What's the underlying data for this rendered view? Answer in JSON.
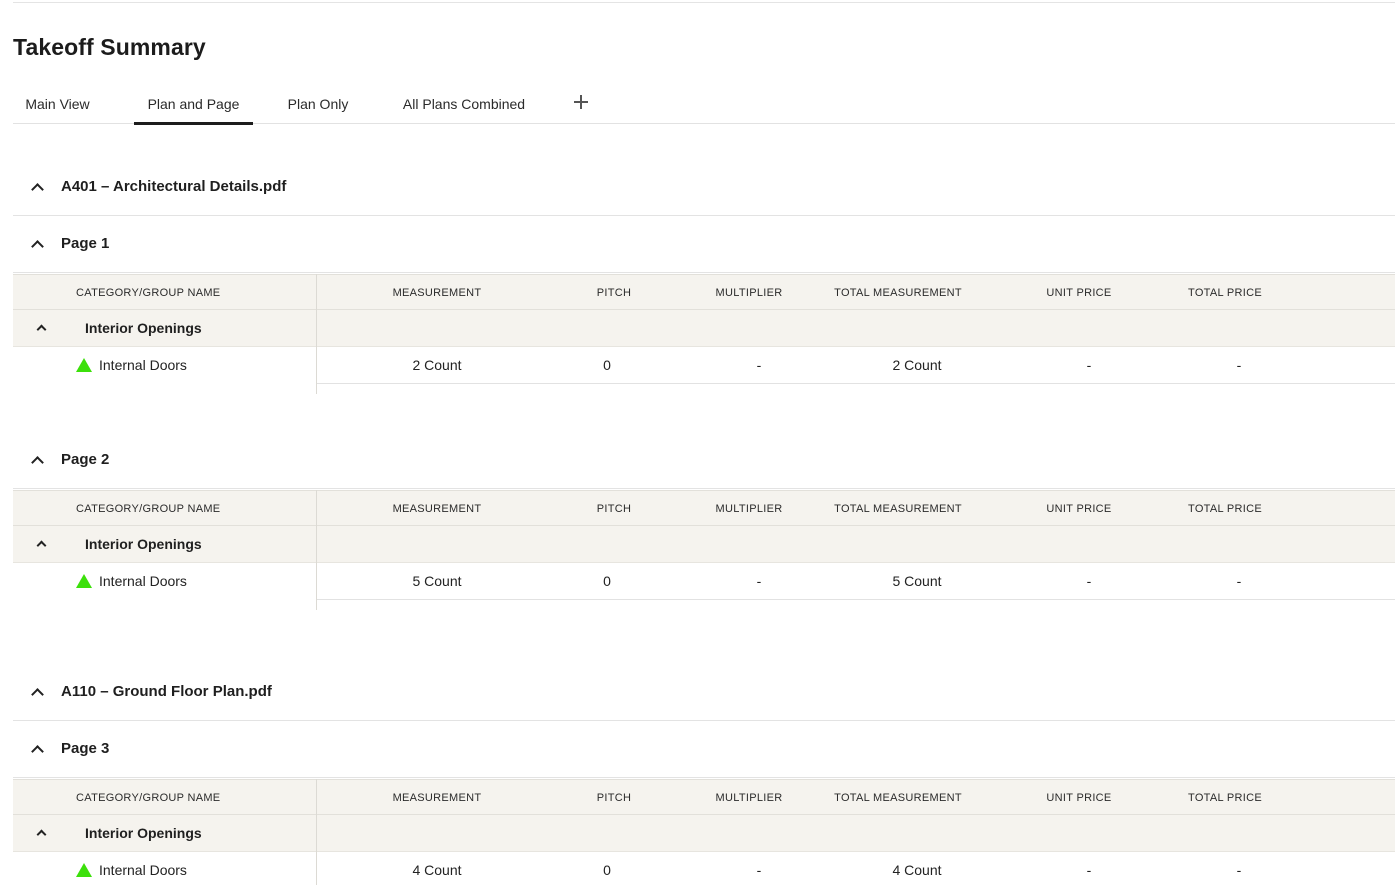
{
  "title": "Takeoff Summary",
  "tabs": [
    {
      "label": "Main View",
      "active": false
    },
    {
      "label": "Plan and Page",
      "active": true
    },
    {
      "label": "Plan Only",
      "active": false
    },
    {
      "label": "All Plans Combined",
      "active": false
    }
  ],
  "add_tab_icon": "plus-icon",
  "columns": {
    "category": "CATEGORY/GROUP NAME",
    "measurement": "MEASUREMENT",
    "pitch": "PITCH",
    "multiplier": "MULTIPLIER",
    "total_measurement": "TOTAL MEASUREMENT",
    "unit_price": "UNIT PRICE",
    "total_price": "TOTAL PRICE"
  },
  "plans": [
    {
      "name": "A401 – Architectural Details.pdf",
      "pages": [
        {
          "name": "Page 1",
          "group": "Interior Openings",
          "item": {
            "name": "Internal Doors",
            "measurement": "2 Count",
            "pitch": "0",
            "multiplier": "-",
            "total_measurement": "2 Count",
            "unit_price": "-",
            "total_price": "-"
          }
        },
        {
          "name": "Page 2",
          "group": "Interior Openings",
          "item": {
            "name": "Internal Doors",
            "measurement": "5 Count",
            "pitch": "0",
            "multiplier": "-",
            "total_measurement": "5 Count",
            "unit_price": "-",
            "total_price": "-"
          }
        }
      ]
    },
    {
      "name": "A110 – Ground Floor Plan.pdf",
      "pages": [
        {
          "name": "Page 3",
          "group": "Interior Openings",
          "item": {
            "name": "Internal Doors",
            "measurement": "4 Count",
            "pitch": "0",
            "multiplier": "-",
            "total_measurement": "4 Count",
            "unit_price": "-",
            "total_price": "-"
          }
        }
      ]
    }
  ],
  "colors": {
    "marker": "#3ce00b",
    "header_bg": "#f5f3ee",
    "active_tab": "#1d1d1d"
  }
}
